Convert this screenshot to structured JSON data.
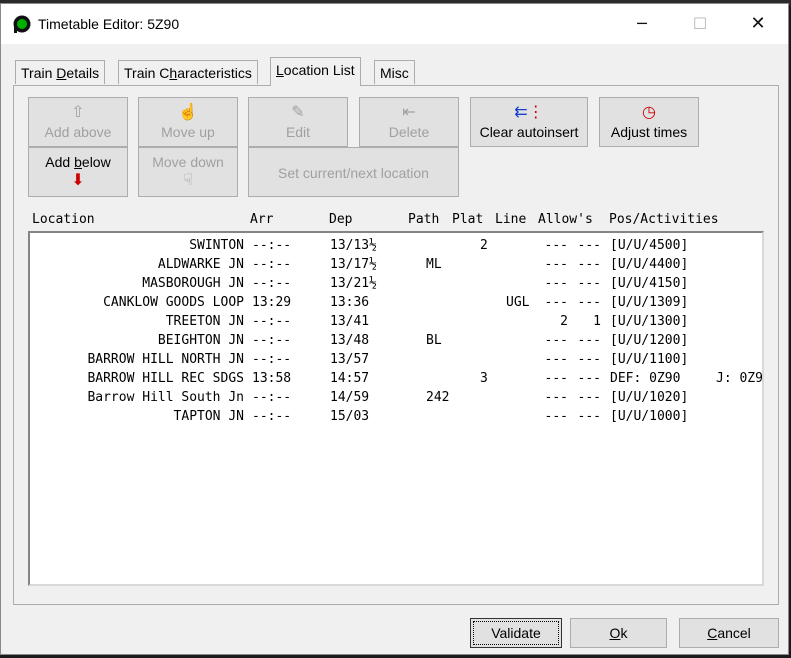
{
  "window": {
    "title": "Timetable Editor: 5Z90"
  },
  "tabs": [
    {
      "pre": "Train ",
      "ul": "D",
      "post": "etails"
    },
    {
      "pre": "Train C",
      "ul": "h",
      "post": "aracteristics"
    },
    {
      "pre": "",
      "ul": "L",
      "post": "ocation List"
    },
    {
      "pre": "",
      "ul": "",
      "post": "Misc"
    }
  ],
  "toolbar": {
    "add_above": "Add above",
    "move_up": "Move up",
    "edit": "Edit",
    "delete": "Delete",
    "clear_autoinsert": "Clear autoinsert",
    "adjust_times": "Adjust times",
    "add_below_pre": "Add ",
    "add_below_ul": "b",
    "add_below_post": "elow",
    "move_down": "Move down",
    "set_current": "Set current/next location"
  },
  "columns": {
    "location": "Location",
    "arr": "Arr",
    "dep": "Dep",
    "path": "Path",
    "plat": "Plat",
    "line": "Line",
    "allows": "Allow's",
    "pos": "Pos/Activities"
  },
  "rows": [
    {
      "loc": "SWINTON",
      "arr": "--:--",
      "dep": "13/13½",
      "path": "",
      "plat": "2",
      "line": "",
      "a1": "---",
      "a2": "---",
      "pos": "[U/U/4500]",
      "extra": ""
    },
    {
      "loc": "ALDWARKE JN",
      "arr": "--:--",
      "dep": "13/17½",
      "path": "ML",
      "plat": "",
      "line": "",
      "a1": "---",
      "a2": "---",
      "pos": "[U/U/4400]",
      "extra": ""
    },
    {
      "loc": "MASBOROUGH JN",
      "arr": "--:--",
      "dep": "13/21½",
      "path": "",
      "plat": "",
      "line": "",
      "a1": "---",
      "a2": "---",
      "pos": "[U/U/4150]",
      "extra": ""
    },
    {
      "loc": "CANKLOW GOODS LOOP",
      "arr": "13:29",
      "dep": "13:36",
      "path": "",
      "plat": "",
      "line": "UGL",
      "a1": "---",
      "a2": "---",
      "pos": "[U/U/1309]",
      "extra": ""
    },
    {
      "loc": "TREETON JN",
      "arr": "--:--",
      "dep": "13/41",
      "path": "",
      "plat": "",
      "line": "",
      "a1": "2",
      "a2": "1",
      "pos": "[U/U/1300]",
      "extra": ""
    },
    {
      "loc": "BEIGHTON JN",
      "arr": "--:--",
      "dep": "13/48",
      "path": "BL",
      "plat": "",
      "line": "",
      "a1": "---",
      "a2": "---",
      "pos": "[U/U/1200]",
      "extra": ""
    },
    {
      "loc": "BARROW HILL NORTH JN",
      "arr": "--:--",
      "dep": "13/57",
      "path": "",
      "plat": "",
      "line": "",
      "a1": "---",
      "a2": "---",
      "pos": "[U/U/1100]",
      "extra": ""
    },
    {
      "loc": "BARROW HILL REC SDGS",
      "arr": "13:58",
      "dep": "14:57",
      "path": "",
      "plat": "3",
      "line": "",
      "a1": "---",
      "a2": "---",
      "pos": "DEF: 0Z90",
      "extra": "J: 0Z9"
    },
    {
      "loc": "Barrow Hill South Jn",
      "arr": "--:--",
      "dep": "14/59",
      "path": "242",
      "plat": "",
      "line": "",
      "a1": "---",
      "a2": "---",
      "pos": "[U/U/1020]",
      "extra": ""
    },
    {
      "loc": "TAPTON JN",
      "arr": "--:--",
      "dep": "15/03",
      "path": "",
      "plat": "",
      "line": "",
      "a1": "---",
      "a2": "---",
      "pos": "[U/U/1000]",
      "extra": ""
    }
  ],
  "dialog": {
    "validate": "Validate",
    "ok_ul": "O",
    "ok_post": "k",
    "cancel_ul": "C",
    "cancel_post": "ancel"
  },
  "icons": {
    "app": "train-signal-icon",
    "add_above": "up-arrow-icon",
    "move_up": "hand-up-icon",
    "edit": "edit-icon",
    "delete": "delete-icon",
    "clear_autoinsert": "clear-autoinsert-icon",
    "adjust_times": "clock-icon",
    "add_below": "down-arrow-icon",
    "move_down": "hand-down-icon"
  },
  "colors": {
    "accent_red": "#cc0000",
    "icon_green": "#00a000"
  }
}
